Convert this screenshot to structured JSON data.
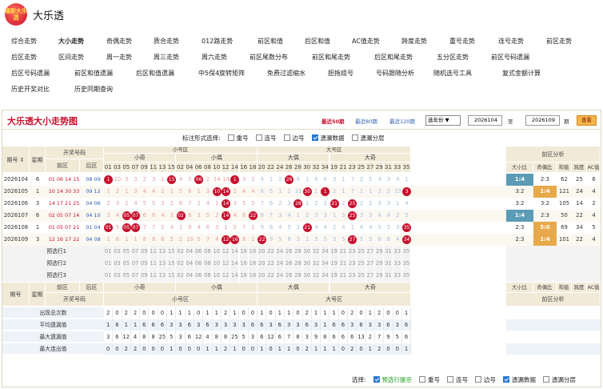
{
  "app": {
    "title": "大乐透",
    "logo_text": "福彩大乐透"
  },
  "nav": {
    "rows": [
      [
        "综合走势",
        "大小走势",
        "奇偶走势",
        "质合走势",
        "012路走势",
        "前区和值",
        "后区和值",
        "AC值走势",
        "跨度走势",
        "重号走势",
        "连号走势",
        "前区走势"
      ],
      [
        "后区走势",
        "区间走势",
        "周一走势",
        "周三走势",
        "周六走势",
        "前区尾数分布",
        "前区和尾走势",
        "后区和尾走势",
        "五分区走势",
        "前区号码遗漏"
      ],
      [
        "后区号码遗漏",
        "前区和值遗漏",
        "后区和值遗漏",
        "中5保4旋转矩阵",
        "免费过滤缩水",
        "胆拖组号",
        "号码跟随分析",
        "随机选号工具",
        "复式金额计算"
      ],
      [
        "历史开奖对比",
        "历史同期查询"
      ]
    ]
  },
  "panel": {
    "title": "大乐透大小走势图",
    "links": [
      "最近50期",
      "最近80期",
      "最近120期"
    ],
    "select": "选年份",
    "from": "2026104",
    "to_label": "至",
    "to": "2026109",
    "period": "期",
    "button": "查看",
    "options_label": "标注形式选择:",
    "options": [
      {
        "label": "重号",
        "on": false
      },
      {
        "label": "连号",
        "on": false
      },
      {
        "label": "边号",
        "on": false
      },
      {
        "label": "遗漏数据",
        "on": true
      },
      {
        "label": "遗漏分层",
        "on": false
      }
    ]
  },
  "headers": {
    "issue": "期号",
    "week": "星期",
    "draw": "开奖号码",
    "front": "前区",
    "back": "后区",
    "small": "小号区",
    "big": "大号区",
    "s_odd": "小奇",
    "s_even": "小偶",
    "b_even": "大偶",
    "b_odd": "大奇",
    "analysis": "前区分析",
    "a_cols": [
      "大小比",
      "奇偶比",
      "和值",
      "跨度",
      "AC值"
    ],
    "nums": [
      "01",
      "03",
      "05",
      "07",
      "09",
      "11",
      "13",
      "15",
      "02",
      "04",
      "06",
      "08",
      "10",
      "12",
      "14",
      "16",
      "18",
      "20",
      "22",
      "24",
      "26",
      "28",
      "30",
      "32",
      "34",
      "19",
      "21",
      "23",
      "25",
      "27",
      "29",
      "31",
      "33",
      "35"
    ]
  },
  "rows": [
    {
      "issue": "2026104",
      "week": "6",
      "front": "01 06 14 15 26",
      "back": "08 09",
      "cells": [
        "1",
        "10",
        "3",
        "3",
        "2",
        "3",
        "1",
        "15",
        "4",
        "5",
        "06",
        "2",
        "14",
        "14",
        "1",
        "3",
        "2",
        "4",
        "1",
        "2",
        "26",
        "6",
        "1",
        "6",
        "6",
        "3",
        "1",
        "7",
        "2",
        "5",
        "4",
        "3",
        "4",
        "1"
      ],
      "hit": [
        0,
        7,
        10,
        14,
        20
      ],
      "a": [
        "1:4",
        "2:3",
        "62",
        "25",
        "6"
      ]
    },
    {
      "issue": "2026105",
      "week": "1",
      "front": "10 14 30 33 34",
      "back": "09 12",
      "cells": [
        "1",
        "2",
        "1",
        "3",
        "4",
        "4",
        "2",
        "1",
        "5",
        "6",
        "1",
        "3",
        "10",
        "14",
        "2",
        "4",
        "4",
        "6",
        "5",
        "1",
        "2",
        "11",
        "30",
        "1",
        "1",
        "2",
        "1",
        "7",
        "1",
        "1",
        "2",
        "2",
        "33",
        "3"
      ],
      "hit": [
        12,
        13,
        22,
        24,
        33
      ],
      "a": [
        "3:2",
        "1:4",
        "121",
        "24",
        "4"
      ]
    },
    {
      "issue": "2026106",
      "week": "3",
      "front": "14 17 21 25 28",
      "back": "04 06",
      "cells": [
        "2",
        "3",
        "2",
        "4",
        "5",
        "5",
        "3",
        "2",
        "6",
        "7",
        "2",
        "4",
        "1",
        "14",
        "3",
        "5",
        "5",
        "7",
        "6",
        "2",
        "3",
        "28",
        "1",
        "2",
        "2",
        "21",
        "2",
        "25",
        "2",
        "2",
        "3",
        "3",
        "1",
        "4"
      ],
      "hit": [
        13,
        21,
        25,
        27
      ],
      "a": [
        "3:2",
        "3:2",
        "105",
        "14",
        "2"
      ]
    },
    {
      "issue": "2026107",
      "week": "6",
      "front": "02 05 07 14 25",
      "back": "04 10",
      "cells": [
        "3",
        "4",
        "05",
        "07",
        "6",
        "6",
        "4",
        "3",
        "02",
        "8",
        "3",
        "5",
        "2",
        "14",
        "4",
        "6",
        "22",
        "8",
        "7",
        "3",
        "4",
        "1",
        "2",
        "3",
        "3",
        "1",
        "3",
        "25",
        "3",
        "3",
        "4",
        "4",
        "2",
        "5"
      ],
      "hit": [
        2,
        3,
        8,
        13,
        16,
        27
      ],
      "a": [
        "1:4",
        "2:3",
        "50",
        "22",
        "4"
      ]
    },
    {
      "issue": "2026108",
      "week": "1",
      "front": "01 05 07 21 35",
      "back": "01 04",
      "cells": [
        "01",
        "5",
        "05",
        "07",
        "7",
        "7",
        "5",
        "4",
        "1",
        "9",
        "4",
        "6",
        "3",
        "1",
        "5",
        "7",
        "1",
        "9",
        "8",
        "4",
        "5",
        "2",
        "21",
        "4",
        "4",
        "2",
        "4",
        "1",
        "4",
        "4",
        "5",
        "5",
        "3",
        "35"
      ],
      "hit": [
        0,
        2,
        3,
        22,
        33
      ],
      "a": [
        "2:3",
        "5:0",
        "69",
        "34",
        "5"
      ]
    },
    {
      "issue": "2026109",
      "week": "3",
      "front": "12 16 17 22 34",
      "back": "04 08",
      "cells": [
        "1",
        "6",
        "1",
        "1",
        "8",
        "8",
        "6",
        "5",
        "2",
        "10",
        "5",
        "7",
        "4",
        "12",
        "16",
        "8",
        "2",
        "22",
        "9",
        "5",
        "6",
        "3",
        "1",
        "5",
        "5",
        "3",
        "5",
        "27",
        "5",
        "5",
        "6",
        "6",
        "4",
        "34"
      ],
      "hit": [
        13,
        14,
        17,
        27,
        33
      ],
      "a": [
        "2:3",
        "1:4",
        "101",
        "22",
        "4"
      ]
    }
  ],
  "pre": [
    "预选行1",
    "预选行2",
    "预选行3"
  ],
  "stats": {
    "labels": [
      "出现总次数",
      "平均遗漏值",
      "最大遗漏值",
      "最大连出值"
    ],
    "rows": [
      [
        "2",
        "0",
        "2",
        "2",
        "0",
        "0",
        "0",
        "1",
        "1",
        "1",
        "0",
        "1",
        "1",
        "2",
        "1",
        "0",
        "0",
        "1",
        "0",
        "1",
        "1",
        "0",
        "2",
        "1",
        "1",
        "1",
        "0",
        "2",
        "0",
        "1",
        "2",
        "0",
        "0",
        "1"
      ],
      [
        "1",
        "6",
        "1",
        "1",
        "6",
        "6",
        "6",
        "3",
        "3",
        "6",
        "3",
        "6",
        "3",
        "3",
        "3",
        "3",
        "6",
        "6",
        "3",
        "6",
        "3",
        "3",
        "6",
        "3",
        "1",
        "6",
        "6",
        "3",
        "6",
        "3",
        "3",
        "6",
        "3",
        "6"
      ],
      [
        "3",
        "6",
        "12",
        "4",
        "8",
        "8",
        "25",
        "5",
        "3",
        "6",
        "12",
        "4",
        "8",
        "8",
        "25",
        "5",
        "3",
        "6",
        "12",
        "6",
        "7",
        "8",
        "3",
        "9",
        "8",
        "6",
        "6",
        "6",
        "13",
        "2",
        "7",
        "9",
        "5",
        "6"
      ],
      [
        "0",
        "0",
        "2",
        "2",
        "0",
        "0",
        "0",
        "1",
        "0",
        "0",
        "0",
        "1",
        "1",
        "2",
        "1",
        "0",
        "0",
        "1",
        "0",
        "1",
        "1",
        "0",
        "2",
        "1",
        "1",
        "1",
        "0",
        "2",
        "0",
        "1",
        "2",
        "0",
        "0",
        "1"
      ]
    ]
  },
  "footer": {
    "label": "选择:",
    "options": [
      {
        "label": "预选行提示",
        "on": true
      },
      {
        "label": "重号",
        "on": false
      },
      {
        "label": "连号",
        "on": false
      },
      {
        "label": "边号",
        "on": false
      },
      {
        "label": "遗漏数据",
        "on": true
      },
      {
        "label": "遗漏分层",
        "on": false
      }
    ]
  }
}
